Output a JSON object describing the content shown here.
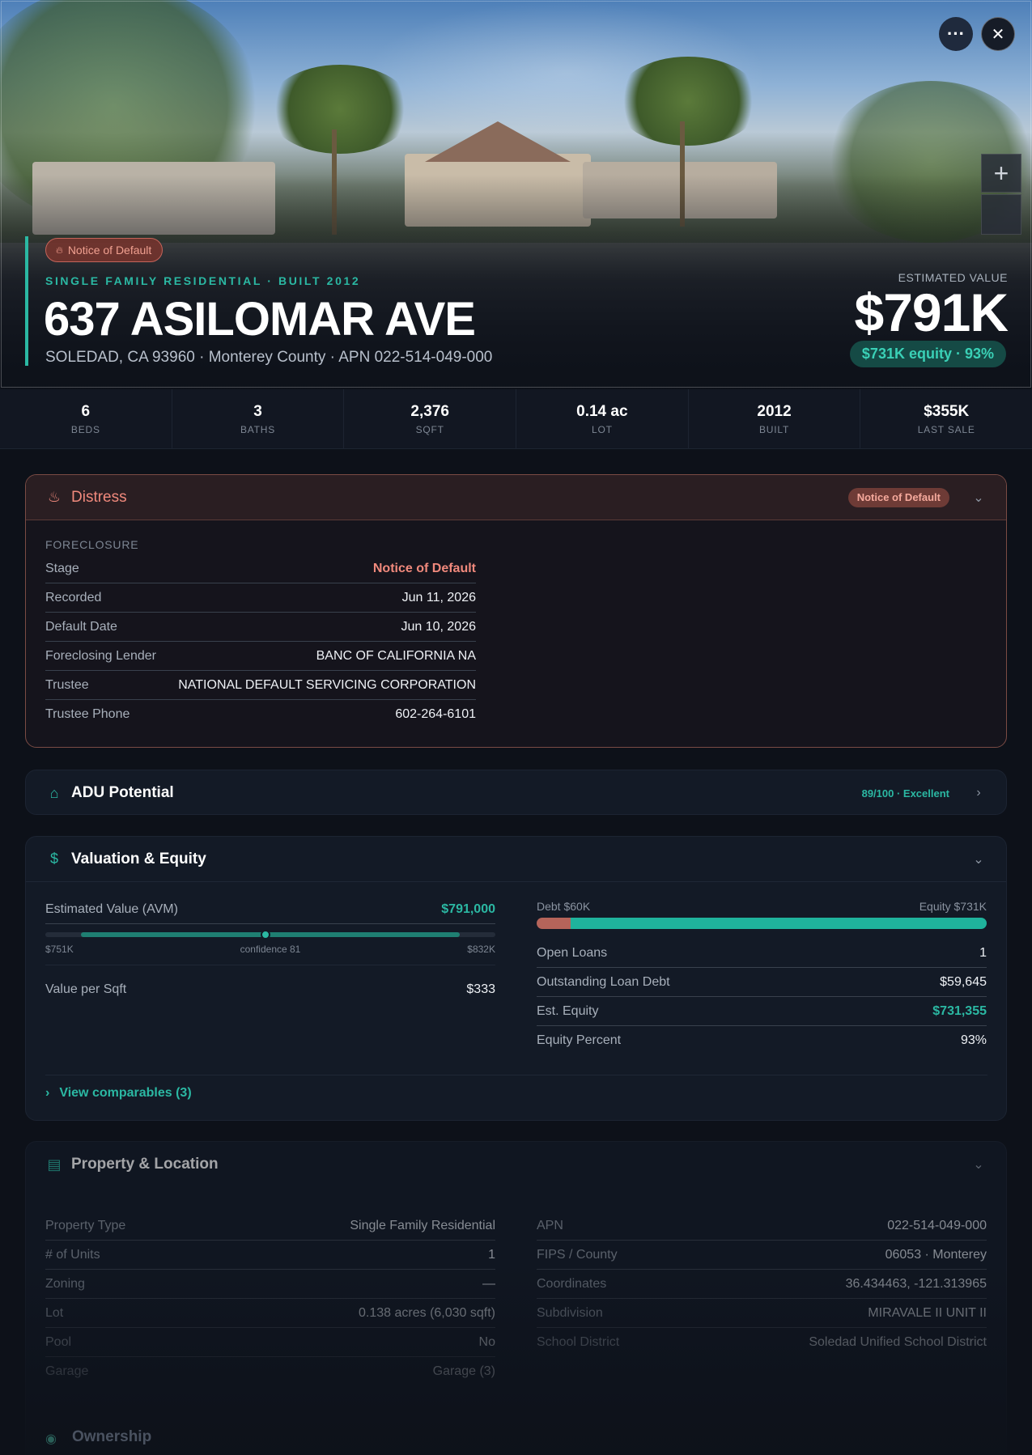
{
  "hero": {
    "badge": "Notice of Default",
    "kicker": "SINGLE FAMILY RESIDENTIAL · BUILT 2012",
    "address": "637 ASILOMAR AVE",
    "subtitle": "SOLEDAD, CA 93960 · Monterey County · APN 022-514-049-000",
    "estimate_label": "ESTIMATED VALUE",
    "estimate_value": "$791K",
    "equity_pill": "$731K equity · 93%",
    "more_icon": "ellipsis-icon",
    "close_icon": "close-icon",
    "zoom_in": "+"
  },
  "stats": [
    {
      "value": "6",
      "label": "BEDS"
    },
    {
      "value": "3",
      "label": "BATHS"
    },
    {
      "value": "2,376",
      "label": "SQFT"
    },
    {
      "value": "0.14 ac",
      "label": "LOT"
    },
    {
      "value": "2012",
      "label": "BUILT"
    },
    {
      "value": "$355K",
      "label": "LAST SALE"
    }
  ],
  "distress": {
    "title": "Distress",
    "badge": "Notice of Default",
    "section": "FORECLOSURE",
    "rows": [
      {
        "k": "Stage",
        "v": "Notice of Default"
      },
      {
        "k": "Recorded",
        "v": "Jun 11, 2026"
      },
      {
        "k": "Default Date",
        "v": "Jun 10, 2026"
      },
      {
        "k": "Foreclosing Lender",
        "v": "BANC OF CALIFORNIA NA"
      },
      {
        "k": "Trustee",
        "v": "NATIONAL DEFAULT SERVICING CORPORATION"
      },
      {
        "k": "Trustee Phone",
        "v": "602-264-6101"
      }
    ]
  },
  "adu": {
    "title": "ADU Potential",
    "score": "89/100 · Excellent"
  },
  "valuation": {
    "title": "Valuation & Equity",
    "avm_label": "Estimated Value (AVM)",
    "avm_value": "$791,000",
    "range_low": "$751K",
    "range_mid": "confidence 81",
    "range_high": "$832K",
    "range_fraction": 0.49,
    "vps_label": "Value per Sqft",
    "vps_value": "$333",
    "debt_label": "Debt $60K",
    "equity_label": "Equity $731K",
    "debt_fraction": 0.075,
    "rows": [
      {
        "k": "Open Loans",
        "v": "1"
      },
      {
        "k": "Outstanding Loan Debt",
        "v": "$59,645"
      },
      {
        "k": "Est. Equity",
        "v": "$731,355"
      },
      {
        "k": "Equity Percent",
        "v": "93%"
      }
    ],
    "comparables": "View comparables (3)"
  },
  "property": {
    "title": "Property & Location",
    "left": [
      {
        "k": "Property Type",
        "v": "Single Family Residential"
      },
      {
        "k": "# of Units",
        "v": "1"
      },
      {
        "k": "Zoning",
        "v": "—"
      },
      {
        "k": "Lot",
        "v": "0.138 acres (6,030 sqft)"
      },
      {
        "k": "Pool",
        "v": "No"
      },
      {
        "k": "Garage",
        "v": "Garage (3)"
      }
    ],
    "right": [
      {
        "k": "APN",
        "v": "022-514-049-000"
      },
      {
        "k": "FIPS / County",
        "v": "06053 · Monterey"
      },
      {
        "k": "Coordinates",
        "v": "36.434463, -121.313965"
      },
      {
        "k": "Subdivision",
        "v": "MIRAVALE II UNIT II"
      },
      {
        "k": "School District",
        "v": "Soledad Unified School District"
      }
    ]
  },
  "ownership": {
    "title": "Ownership"
  }
}
